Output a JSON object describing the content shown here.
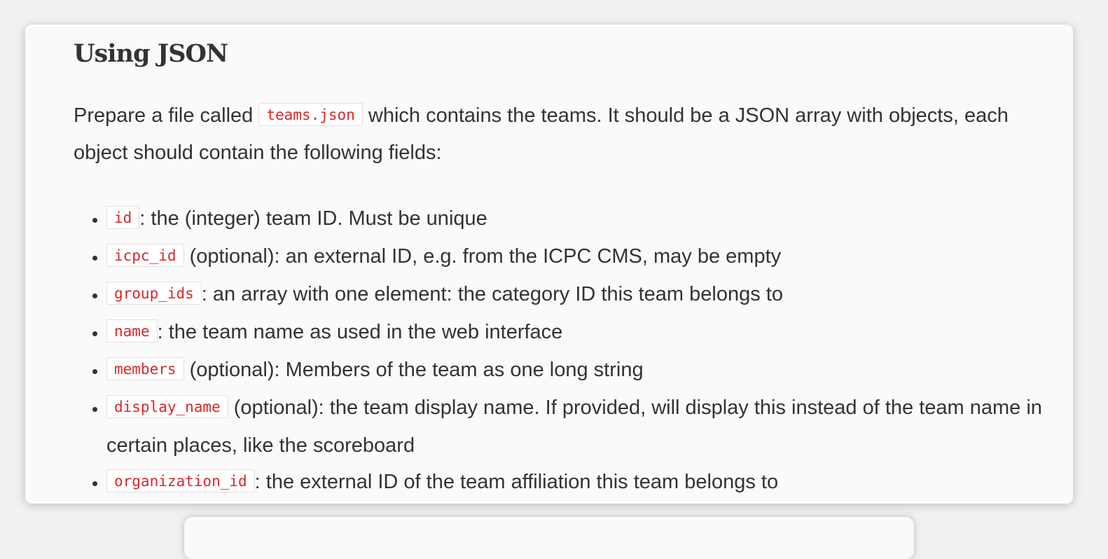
{
  "section": {
    "title": "Using JSON",
    "intro": {
      "before": "Prepare a file called ",
      "filename": "teams.json",
      "after": " which contains the teams. It should be a JSON array with objects, each object should contain the following fields:"
    },
    "fields": [
      {
        "code": "id",
        "text": ": the (integer) team ID. Must be unique"
      },
      {
        "code": "icpc_id",
        "text": " (optional): an external ID, e.g. from the ICPC CMS, may be empty"
      },
      {
        "code": "group_ids",
        "text": ": an array with one element: the category ID this team belongs to"
      },
      {
        "code": "name",
        "text": ": the team name as used in the web interface"
      },
      {
        "code": "members",
        "text": " (optional): Members of the team as one long string"
      },
      {
        "code": "display_name",
        "text": " (optional): the team display name. If provided, will display this instead of the team name in certain places, like the scoreboard"
      },
      {
        "code": "organization_id",
        "text": ": the external ID of the team affiliation this team belongs to"
      }
    ]
  },
  "colors": {
    "code_text": "#d6272a",
    "body_text": "#333333",
    "card_background": "#fafafa"
  }
}
